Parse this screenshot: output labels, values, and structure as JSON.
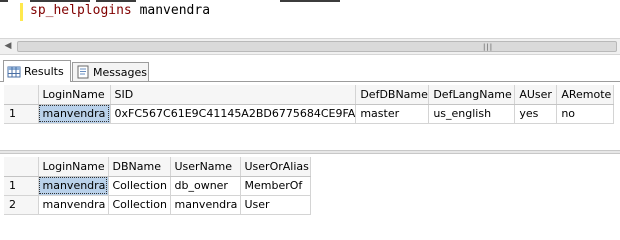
{
  "editor": {
    "keyword": "sp_helplogins",
    "argument": "manvendra"
  },
  "tabs": [
    {
      "label": "Results",
      "icon": "grid-icon",
      "active": true
    },
    {
      "label": "Messages",
      "icon": "document-icon",
      "active": false
    }
  ],
  "grid1": {
    "columns": [
      "LoginName",
      "SID",
      "DefDBName",
      "DefLangName",
      "AUser",
      "ARemote"
    ],
    "rows": [
      {
        "num": "1",
        "cells": [
          "manvendra",
          "0xFC567C61E9C41145A2BD6775684CE9FA",
          "master",
          "us_english",
          "yes",
          "no"
        ]
      }
    ]
  },
  "grid2": {
    "columns": [
      "LoginName",
      "DBName",
      "UserName",
      "UserOrAlias"
    ],
    "rows": [
      {
        "num": "1",
        "cells": [
          "manvendra",
          "Collection",
          "db_owner",
          "MemberOf"
        ]
      },
      {
        "num": "2",
        "cells": [
          "manvendra",
          "Collection",
          "manvendra",
          "User"
        ]
      }
    ]
  },
  "colors": {
    "keyword": "#800000",
    "selection": "#b9d1ea",
    "line_marker": "#ffe94d"
  }
}
